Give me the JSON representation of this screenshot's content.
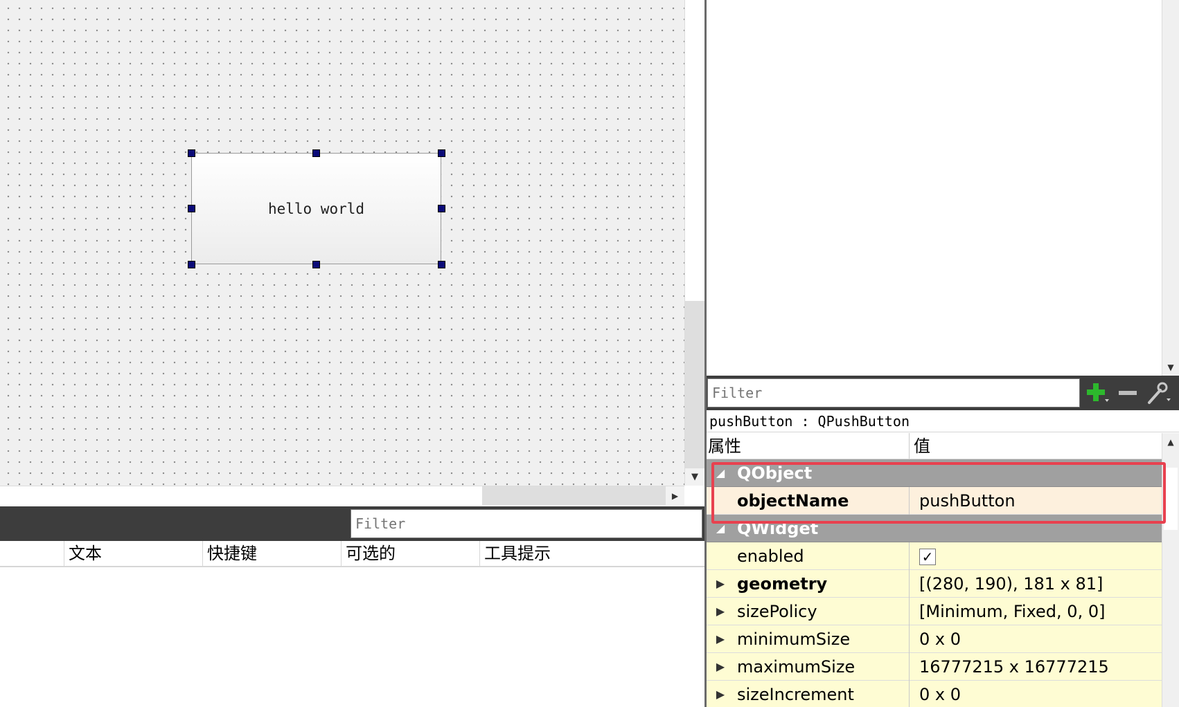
{
  "form": {
    "button_text": "hello world"
  },
  "action_editor": {
    "filter_placeholder": "Filter",
    "columns": [
      "",
      "文本",
      "快捷键",
      "可选的",
      "工具提示"
    ]
  },
  "property_editor": {
    "filter_placeholder": "Filter",
    "object_label": "pushButton : QPushButton",
    "header_property": "属性",
    "header_value": "值",
    "groups": {
      "qobject": "QObject",
      "qwidget": "QWidget"
    },
    "rows": {
      "objectName": {
        "name": "objectName",
        "value": "pushButton"
      },
      "enabled": {
        "name": "enabled",
        "value": "✓"
      },
      "geometry": {
        "name": "geometry",
        "value": "[(280, 190), 181 x 81]"
      },
      "sizePolicy": {
        "name": "sizePolicy",
        "value": "[Minimum, Fixed, 0, 0]"
      },
      "minimumSize": {
        "name": "minimumSize",
        "value": "0 x 0"
      },
      "maximumSize": {
        "name": "maximumSize",
        "value": "16777215 x 16777215"
      },
      "sizeIncrement": {
        "name": "sizeIncrement",
        "value": "0 x 0"
      }
    },
    "icons": [
      "plus-icon",
      "minus-icon",
      "wrench-icon"
    ],
    "colors": {
      "highlight": "#e8414f",
      "group_bg": "#a0a0a0",
      "qobject_row_bg": "#fdf0dd",
      "qwidget_row_bg": "#fefcd3",
      "add_icon": "#2db82d"
    }
  }
}
